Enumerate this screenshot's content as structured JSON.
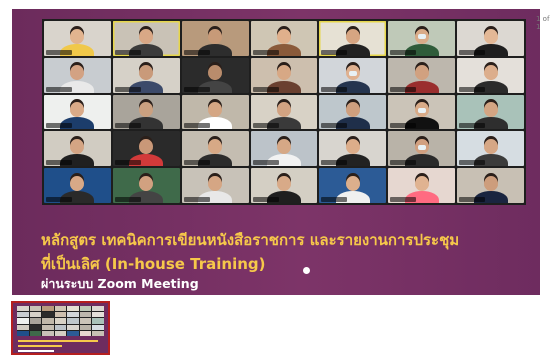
{
  "page_counter": "1 of 1",
  "slide": {
    "title_line1": "หลักสูตร เทคนิคการเขียนหนังสือราชการ และรายงานการประชุม",
    "title_line2": "ที่เป็นเลิศ (In-house Training)",
    "subtitle": "ผ่านระบบ Zoom Meeting",
    "colors": {
      "background": "#7d3468",
      "title": "#f6c84a",
      "subtitle": "#ffffff"
    }
  },
  "video_tiles": [
    {
      "bg": "#d9d4cc",
      "skin": "#e2b48f",
      "shirt": "#f0c84a"
    },
    {
      "bg": "#c9c2b6",
      "skin": "#d9a886",
      "shirt": "#3b3b3b",
      "speaking": true
    },
    {
      "bg": "#b89a7c",
      "skin": "#c79a78",
      "shirt": "#2d2d2d"
    },
    {
      "bg": "#cfc6b4",
      "skin": "#e0b08c",
      "shirt": "#8a5a3a"
    },
    {
      "bg": "#e6e1d4",
      "skin": "#d6a582",
      "shirt": "#222222",
      "speaking": true
    },
    {
      "bg": "#bfc9b8",
      "skin": "#d9ab88",
      "shirt": "#2f5c3a",
      "mask": true
    },
    {
      "bg": "#dcd8d2",
      "skin": "#e3b896",
      "shirt": "#1e1e1e"
    },
    {
      "bg": "#c8ccd0",
      "skin": "#d3a283",
      "shirt": "#e9e9e9"
    },
    {
      "bg": "#d6d1c8",
      "skin": "#c99a7a",
      "shirt": "#3c4a6a"
    },
    {
      "bg": "#2b2b2b",
      "skin": "#b98c6c",
      "shirt": "#444444"
    },
    {
      "bg": "#cdbfae",
      "skin": "#d7a885",
      "shirt": "#6a4030"
    },
    {
      "bg": "#d2d6da",
      "skin": "#dfb190",
      "shirt": "#25354f",
      "mask": true
    },
    {
      "bg": "#bdb7ad",
      "skin": "#d1a180",
      "shirt": "#9a2e2e"
    },
    {
      "bg": "#e4e0da",
      "skin": "#dcae8c",
      "shirt": "#2b2b2b"
    },
    {
      "bg": "#eef0ee",
      "skin": "#d9aa88",
      "shirt": "#1c3d6b"
    },
    {
      "bg": "#a9a49b",
      "skin": "#caa080",
      "shirt": "#333333"
    },
    {
      "bg": "#c0b8aa",
      "skin": "#d4a684",
      "shirt": "#ffffff"
    },
    {
      "bg": "#d8d2c6",
      "skin": "#d2a382",
      "shirt": "#3a3a3a"
    },
    {
      "bg": "#bec7cc",
      "skin": "#cf9f7e",
      "shirt": "#1f2f4a"
    },
    {
      "bg": "#cbc4b8",
      "skin": "#d8ab88",
      "shirt": "#111111",
      "mask": true
    },
    {
      "bg": "#a9c2b9",
      "skin": "#d3a583",
      "shirt": "#2e2e2e"
    },
    {
      "bg": "#d1ccc2",
      "skin": "#d4a584",
      "shirt": "#202020"
    },
    {
      "bg": "#2a2a2a",
      "skin": "#c99878",
      "shirt": "#d23a3a"
    },
    {
      "bg": "#c4bdb1",
      "skin": "#d7a986",
      "shirt": "#2c2c2c"
    },
    {
      "bg": "#bcc3c9",
      "skin": "#d6a886",
      "shirt": "#f2f2f2"
    },
    {
      "bg": "#d8d5cf",
      "skin": "#dcad8a",
      "shirt": "#222222"
    },
    {
      "bg": "#b9b3a8",
      "skin": "#d1a080",
      "shirt": "#2a2a2a",
      "mask": true
    },
    {
      "bg": "#d6dde2",
      "skin": "#d6a785",
      "shirt": "#3b3b3b"
    },
    {
      "bg": "#1f4f8a",
      "skin": "#d8a987",
      "shirt": "#2a2a2a"
    },
    {
      "bg": "#3f6a4a",
      "skin": "#d1a180",
      "shirt": "#444444"
    },
    {
      "bg": "#c8c2b8",
      "skin": "#d5a684",
      "shirt": "#e8e8e8"
    },
    {
      "bg": "#d4cfc4",
      "skin": "#d8aa88",
      "shirt": "#1f1f1f"
    },
    {
      "bg": "#2c5b96",
      "skin": "#dcaf8c",
      "shirt": "#f0f0f0"
    },
    {
      "bg": "#e6d7d0",
      "skin": "#e0b391",
      "shirt": "#ff6b81"
    },
    {
      "bg": "#c8c0b4",
      "skin": "#cd9d7c",
      "shirt": "#1a2540"
    }
  ]
}
